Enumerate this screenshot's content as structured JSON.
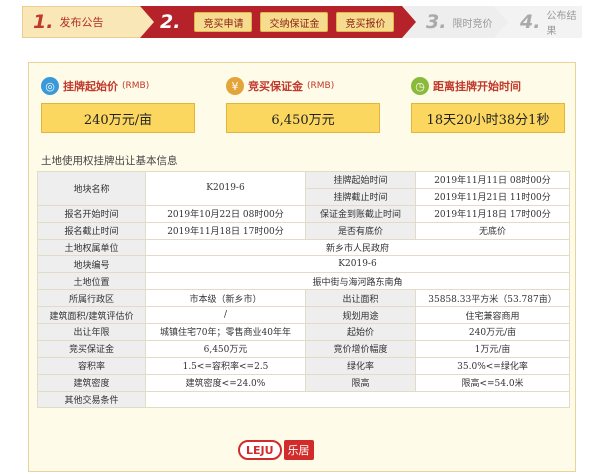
{
  "steps": {
    "step1": {
      "num": "1.",
      "label": "发布公告"
    },
    "step2": {
      "num": "2.",
      "subs": [
        "竞买申请",
        "交纳保证金",
        "竞买报价"
      ]
    },
    "step3": {
      "num": "3.",
      "label": "限时竞价"
    },
    "step4": {
      "num": "4.",
      "label": "公布结果"
    }
  },
  "cards": [
    {
      "title": "挂牌起始价",
      "unit": "(RMB)",
      "value": "240万元/亩",
      "icon": "globe-icon",
      "color": "#3a9ad9"
    },
    {
      "title": "竞买保证金",
      "unit": "(RMB)",
      "value": "6,450万元",
      "icon": "coins-icon",
      "color": "#e3a53a"
    },
    {
      "title": "距离挂牌开始时间",
      "unit": "",
      "value": "18天20小时38分1秒",
      "icon": "clock-icon",
      "color": "#8bb93a"
    }
  ],
  "section_title": "土地使用权挂牌出让基本信息",
  "table": {
    "r1": {
      "l1": "地块名称",
      "v1": "K2019-6",
      "l2": "挂牌起始时间",
      "v2": "2019年11月11日 08时00分"
    },
    "r2": {
      "l2": "挂牌截止时间",
      "v2": "2019年11月21日 11时00分"
    },
    "r3": {
      "l1": "报名开始时间",
      "v1": "2019年10月22日 08时00分",
      "l2": "保证金到账截止时间",
      "v2": "2019年11月18日 17时00分"
    },
    "r4": {
      "l1": "报名截止时间",
      "v1": "2019年11月18日 17时00分",
      "l2": "是否有底价",
      "v2": "无底价"
    },
    "r5": {
      "l": "土地权属单位",
      "v": "新乡市人民政府"
    },
    "r6": {
      "l": "地块编号",
      "v": "K2019-6"
    },
    "r7": {
      "l": "土地位置",
      "v": "振中街与海河路东南角"
    },
    "r8": {
      "l1": "所属行政区",
      "v1": "市本级（新乡市）",
      "l2": "出让面积",
      "v2": "35858.33平方米（53.787亩）"
    },
    "r9": {
      "l1": "建筑面积/建筑评估价",
      "v1": "/",
      "l2": "规划用途",
      "v2": "住宅兼容商用"
    },
    "r10": {
      "l1": "出让年限",
      "v1": "城镇住宅70年；零售商业40年年",
      "l2": "起始价",
      "v2": "240万元/亩"
    },
    "r11": {
      "l1": "竞买保证金",
      "v1": "6,450万元",
      "l2": "竞价增价幅度",
      "v2": "1万元/亩"
    },
    "r12": {
      "l1": "容积率",
      "v1": "1.5<=容积率<=2.5",
      "l2": "绿化率",
      "v2": "35.0%<=绿化率"
    },
    "r13": {
      "l1": "建筑密度",
      "v1": "建筑密度<=24.0%",
      "l2": "限高",
      "v2": "限高<=54.0米"
    },
    "r14": {
      "l": "其他交易条件",
      "v": ""
    }
  },
  "logo": {
    "mark": "LEJU",
    "text": "乐居"
  }
}
